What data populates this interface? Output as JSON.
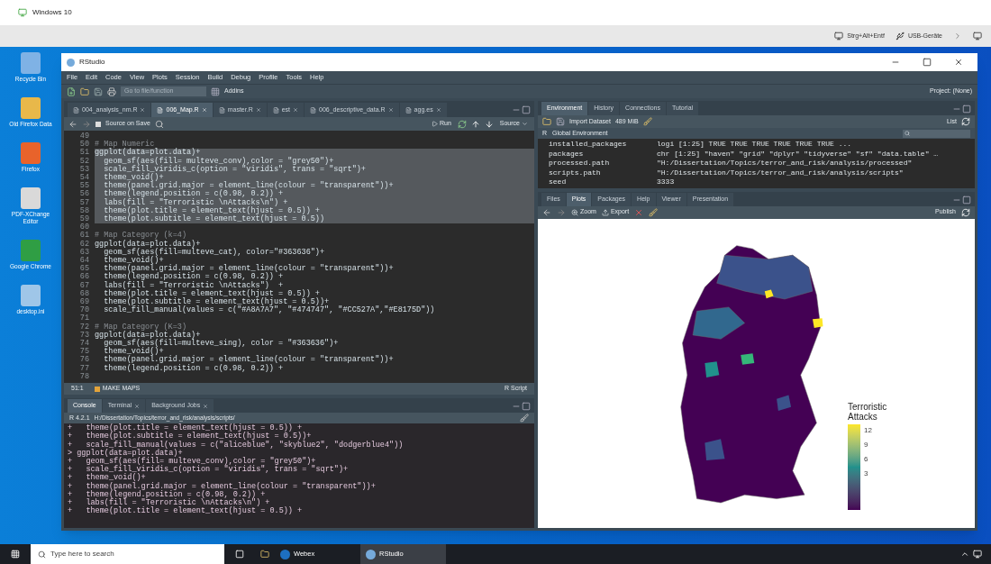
{
  "vm": {
    "title": "Windows 10",
    "toolbar": [
      "Strg+Alt+Entf",
      "USB-Geräte"
    ]
  },
  "desktop_icons": [
    {
      "label": "Recycle Bin",
      "color": "#7fb2e5"
    },
    {
      "label": "Old Firefox Data",
      "color": "#e8b84a"
    },
    {
      "label": "Firefox",
      "color": "#e8632b"
    },
    {
      "label": "PDF-XChange Editor",
      "color": "#d9d9d9"
    },
    {
      "label": "Google Chrome",
      "color": "#2f9e44"
    },
    {
      "label": "desktop.ini",
      "color": "#9fc6e8"
    }
  ],
  "rstudio": {
    "title": "RStudio",
    "menu": [
      "File",
      "Edit",
      "Code",
      "View",
      "Plots",
      "Session",
      "Build",
      "Debug",
      "Profile",
      "Tools",
      "Help"
    ],
    "toolbar": {
      "goto_placeholder": "Go to file/function",
      "addins": "Addins",
      "project": "Project: (None)"
    },
    "editor": {
      "tabs": [
        {
          "label": "004_analysis_nm.R",
          "selected": false
        },
        {
          "label": "006_Map.R",
          "selected": true
        },
        {
          "label": "master.R",
          "selected": false
        },
        {
          "label": "est",
          "selected": false
        },
        {
          "label": "006_descriptive_data.R",
          "selected": false
        },
        {
          "label": "agg.es",
          "selected": false
        }
      ],
      "source_on_save": "Source on Save",
      "source_on_save_checked": false,
      "run": "Run",
      "source": "Source",
      "lines": [
        {
          "n": "49",
          "kind": "code",
          "selected": false
        },
        {
          "n": "50",
          "text": "# Map Numeric",
          "kind": "comment",
          "selected": false
        },
        {
          "n": "51",
          "text": "ggplot(data=plot.data)+",
          "kind": "code",
          "selected": true
        },
        {
          "n": "52",
          "text": "  geom_sf(aes(fill= multeve_conv),color = \"grey50\")+",
          "kind": "code",
          "selected": true
        },
        {
          "n": "53",
          "text": "  scale_fill_viridis_c(option = \"viridis\", trans = \"sqrt\")+",
          "kind": "code",
          "selected": true
        },
        {
          "n": "54",
          "text": "  theme_void()+",
          "kind": "code",
          "selected": true
        },
        {
          "n": "55",
          "text": "  theme(panel.grid.major = element_line(colour = \"transparent\"))+",
          "kind": "code",
          "selected": true
        },
        {
          "n": "56",
          "text": "  theme(legend.position = c(0.98, 0.2)) +",
          "kind": "code",
          "selected": true
        },
        {
          "n": "57",
          "text": "  labs(fill = \"Terroristic \\nAttacks\\n\") +",
          "kind": "code",
          "selected": true
        },
        {
          "n": "58",
          "text": "  theme(plot.title = element_text(hjust = 0.5)) +",
          "kind": "code",
          "selected": true
        },
        {
          "n": "59",
          "text": "  theme(plot.subtitle = element_text(hjust = 0.5))",
          "kind": "code",
          "selected": true
        },
        {
          "n": "60",
          "kind": "code",
          "selected": false
        },
        {
          "n": "61",
          "text": "# Map Category (k=4)",
          "kind": "comment",
          "selected": false
        },
        {
          "n": "62",
          "text": "ggplot(data=plot.data)+",
          "kind": "code",
          "selected": false
        },
        {
          "n": "63",
          "text": "  geom_sf(aes(fill=multeve_cat), color=\"#363636\")+",
          "kind": "code",
          "selected": false
        },
        {
          "n": "64",
          "text": "  theme_void()+",
          "kind": "code",
          "selected": false
        },
        {
          "n": "65",
          "text": "  theme(panel.grid.major = element_line(colour = \"transparent\"))+",
          "kind": "code",
          "selected": false
        },
        {
          "n": "66",
          "text": "  theme(legend.position = c(0.98, 0.2)) +",
          "kind": "code",
          "selected": false
        },
        {
          "n": "67",
          "text": "  labs(fill = \"Terroristic \\nAttacks\")  +",
          "kind": "code",
          "selected": false
        },
        {
          "n": "68",
          "text": "  theme(plot.title = element_text(hjust = 0.5)) +",
          "kind": "code",
          "selected": false
        },
        {
          "n": "69",
          "text": "  theme(plot.subtitle = element_text(hjust = 0.5))+",
          "kind": "code",
          "selected": false
        },
        {
          "n": "70",
          "text": "  scale_fill_manual(values = c(\"#A8A7A7\", \"#474747\", \"#CC527A\",\"#E8175D\"))",
          "kind": "code",
          "selected": false
        },
        {
          "n": "71",
          "kind": "code",
          "selected": false
        },
        {
          "n": "72",
          "text": "# Map Category (K=3)",
          "kind": "comment",
          "selected": false
        },
        {
          "n": "73",
          "text": "ggplot(data=plot.data)+",
          "kind": "code",
          "selected": false
        },
        {
          "n": "74",
          "text": "  geom_sf(aes(fill=multeve_sing), color = \"#363636\")+",
          "kind": "code",
          "selected": false
        },
        {
          "n": "75",
          "text": "  theme_void()+",
          "kind": "code",
          "selected": false
        },
        {
          "n": "76",
          "text": "  theme(panel.grid.major = element_line(colour = \"transparent\"))+",
          "kind": "code",
          "selected": false
        },
        {
          "n": "77",
          "text": "  theme(legend.position = c(0.98, 0.2)) +",
          "kind": "code",
          "selected": false
        },
        {
          "n": "78",
          "kind": "code",
          "selected": false
        }
      ],
      "position": "51:1",
      "section": "MAKE MAPS",
      "filetype": "R Script"
    },
    "console": {
      "tabs": [
        {
          "label": "Console",
          "selected": true
        },
        {
          "label": "Terminal",
          "selected": false
        },
        {
          "label": "Background Jobs",
          "selected": false
        }
      ],
      "version": "R 4.2.1",
      "path": "H:/Dissertation/Topics/terror_and_risk/analysis/scripts/",
      "lines": [
        {
          "prompt": "+",
          "text": "  theme(plot.title = element_text(hjust = 0.5)) +"
        },
        {
          "prompt": "+",
          "text": "  theme(plot.subtitle = element_text(hjust = 0.5))+"
        },
        {
          "prompt": "+",
          "text": "  scale_fill_manual(values = c(\"aliceblue\", \"skyblue2\", \"dodgerblue4\"))"
        },
        {
          "prompt": ">",
          "text": "ggplot(data=plot.data)+"
        },
        {
          "prompt": "+",
          "text": "  geom_sf(aes(fill= multeve_conv),color = \"grey50\")+"
        },
        {
          "prompt": "+",
          "text": "  scale_fill_viridis_c(option = \"viridis\", trans = \"sqrt\")+"
        },
        {
          "prompt": "+",
          "text": "  theme_void()+"
        },
        {
          "prompt": "+",
          "text": "  theme(panel.grid.major = element_line(colour = \"transparent\"))+"
        },
        {
          "prompt": "+",
          "text": "  theme(legend.position = c(0.98, 0.2)) +"
        },
        {
          "prompt": "+",
          "text": "  labs(fill = \"Terroristic \\nAttacks\\n\") +"
        },
        {
          "prompt": "+",
          "text": "  theme(plot.title = element_text(hjust = 0.5)) +"
        }
      ]
    },
    "environment": {
      "tabs": [
        {
          "label": "Environment",
          "selected": true
        },
        {
          "label": "History",
          "selected": false
        },
        {
          "label": "Connections",
          "selected": false
        },
        {
          "label": "Tutorial",
          "selected": false
        }
      ],
      "import": "Import Dataset",
      "memory": "489 MiB",
      "view": "List",
      "lang": "R",
      "scope": "Global Environment",
      "rows": [
        {
          "name": "installed_packages",
          "value": "logi [1:25] TRUE TRUE TRUE TRUE TRUE TRUE ..."
        },
        {
          "name": "packages",
          "value": "chr [1:25] \"haven\" \"grid\" \"dplyr\" \"tidyverse\" \"sf\" \"data.table\" …"
        },
        {
          "name": "processed.path",
          "value": "\"H:/Dissertation/Topics/terror_and_risk/analysis/processed\""
        },
        {
          "name": "scripts.path",
          "value": "\"H:/Dissertation/Topics/terror_and_risk/analysis/scripts\""
        },
        {
          "name": "seed",
          "value": "3333"
        }
      ]
    },
    "plots": {
      "tabs": [
        {
          "label": "Files",
          "selected": false
        },
        {
          "label": "Plots",
          "selected": true
        },
        {
          "label": "Packages",
          "selected": false
        },
        {
          "label": "Help",
          "selected": false
        },
        {
          "label": "Viewer",
          "selected": false
        },
        {
          "label": "Presentation",
          "selected": false
        }
      ],
      "zoom": "Zoom",
      "export": "Export",
      "publish": "Publish",
      "legend_title": "Terroristic Attacks",
      "legend_ticks": [
        "12",
        "9",
        "6",
        "3"
      ]
    }
  },
  "taskbar": {
    "search_placeholder": "Type here to search",
    "apps": [
      {
        "label": "Webex",
        "selected": false,
        "color": "#1d6fc1"
      },
      {
        "label": "RStudio",
        "selected": true,
        "color": "#75aadb"
      }
    ]
  }
}
